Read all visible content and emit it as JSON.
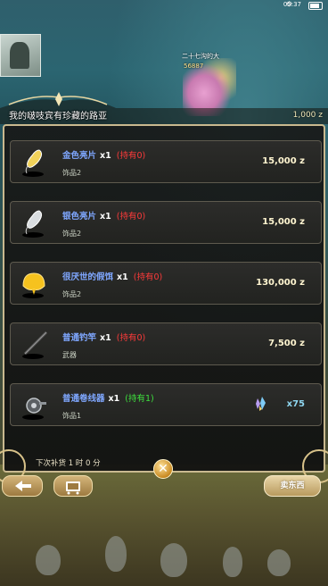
{
  "status_bar": {
    "time": "05:37",
    "battery_icon": "battery-icon"
  },
  "npc": {
    "name_line1": "二十七沟的大",
    "name_line2": "56887"
  },
  "header": {
    "title": "我的啵吱宾有珍藏的路亚",
    "gold": "1,000 z"
  },
  "shop": {
    "items": [
      {
        "name": "金色亮片",
        "qty": "x1",
        "own": "(持有0)",
        "own_color": "#ff3a3a",
        "category": "饰品2",
        "price": "15,000 z",
        "icon": "gold-spoon-lure-icon"
      },
      {
        "name": "银色亮片",
        "qty": "x1",
        "own": "(持有0)",
        "own_color": "#ff3a3a",
        "category": "饰品2",
        "price": "15,000 z",
        "icon": "silver-spoon-lure-icon"
      },
      {
        "name": "很厌世的假饵",
        "qty": "x1",
        "own": "(持有0)",
        "own_color": "#ff3a3a",
        "category": "饰品2",
        "price": "130,000 z",
        "icon": "yellow-bait-icon"
      },
      {
        "name": "普通钓竿",
        "qty": "x1",
        "own": "(持有0)",
        "own_color": "#ff3a3a",
        "category": "武器",
        "price": "7,500 z",
        "icon": "fishing-rod-icon"
      },
      {
        "name": "普通卷线器",
        "qty": "x1",
        "own": "(持有1)",
        "own_color": "#3ee03e",
        "category": "饰品1",
        "cost": "x75",
        "icon": "fishing-reel-icon"
      }
    ],
    "restock": "下次补货 1 时 0 分",
    "sell_label": "卖东西"
  }
}
